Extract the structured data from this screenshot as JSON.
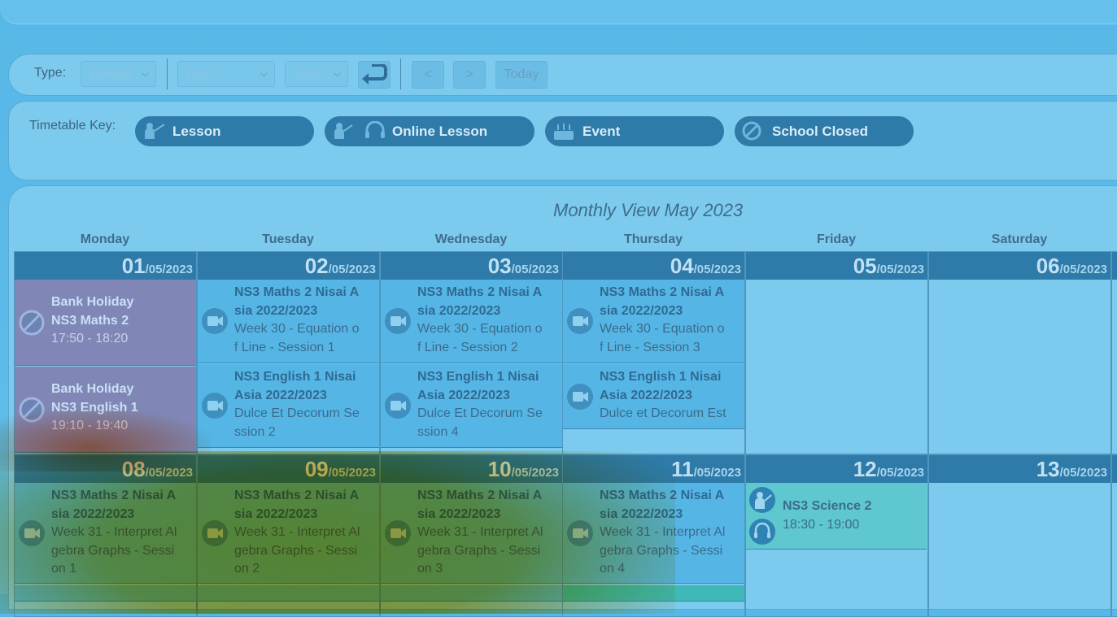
{
  "toolbar": {
    "type_label": "Type:",
    "type_value": "Monthly",
    "month_value": "May",
    "year_value": "2023",
    "prev_label": "<",
    "next_label": ">",
    "today_label": "Today"
  },
  "key": {
    "label": "Timetable Key:",
    "items": [
      {
        "label": "Lesson",
        "icon": "teacher-icon"
      },
      {
        "label": "Online Lesson",
        "icon": "teacher-headset-icon"
      },
      {
        "label": "Event",
        "icon": "cake-icon"
      },
      {
        "label": "School Closed",
        "icon": "no-entry-icon"
      }
    ]
  },
  "calendar": {
    "title": "Monthly View May 2023",
    "days": [
      "Monday",
      "Tuesday",
      "Wednesday",
      "Thursday",
      "Friday",
      "Saturday"
    ],
    "week1": [
      {
        "num": "01",
        "month": "/05/2023"
      },
      {
        "num": "02",
        "month": "/05/2023"
      },
      {
        "num": "03",
        "month": "/05/2023"
      },
      {
        "num": "04",
        "month": "/05/2023"
      },
      {
        "num": "05",
        "month": "/05/2023"
      },
      {
        "num": "06",
        "month": "/05/2023"
      }
    ],
    "week2": [
      {
        "num": "08",
        "month": "/05/2023"
      },
      {
        "num": "09",
        "month": "/05/2023"
      },
      {
        "num": "10",
        "month": "/05/2023"
      },
      {
        "num": "11",
        "month": "/05/2023"
      },
      {
        "num": "12",
        "month": "/05/2023"
      },
      {
        "num": "13",
        "month": "/05/2023"
      }
    ],
    "events": {
      "mon1a": [
        "Bank Holiday",
        "NS3 Maths 2",
        "17:50 - 18:20"
      ],
      "mon1b": [
        "Bank Holiday",
        "NS3 English 1",
        "19:10 - 19:40"
      ],
      "tue2a": [
        "NS3 Maths 2 Nisai A",
        "sia 2022/2023",
        "Week 30 - Equation o",
        "f Line - Session 1"
      ],
      "tue2b": [
        "NS3 English 1 Nisai",
        "Asia 2022/2023",
        "Dulce Et Decorum Se",
        "ssion 2"
      ],
      "wed3a": [
        "NS3 Maths 2 Nisai A",
        "sia 2022/2023",
        "Week 30 - Equation o",
        "f Line - Session 2"
      ],
      "wed3b": [
        "NS3 English 1 Nisai",
        "Asia 2022/2023",
        "Dulce Et Decorum Se",
        "ssion 4"
      ],
      "thu4a": [
        "NS3 Maths 2 Nisai A",
        "sia 2022/2023",
        "Week 30 - Equation o",
        "f Line - Session 3"
      ],
      "thu4b": [
        "NS3 English 1 Nisai",
        "Asia 2022/2023",
        "Dulce et Decorum Est"
      ],
      "mon8": [
        "NS3 Maths 2 Nisai A",
        "sia 2022/2023",
        "Week 31 - Interpret Al",
        "gebra Graphs - Sessi",
        "on 1"
      ],
      "tue9": [
        "NS3 Maths 2 Nisai A",
        "sia 2022/2023",
        "Week 31 - Interpret Al",
        "gebra Graphs - Sessi",
        "on 2"
      ],
      "wed10": [
        "NS3 Maths 2 Nisai A",
        "sia 2022/2023",
        "Week 31 - Interpret Al",
        "gebra Graphs - Sessi",
        "on 3"
      ],
      "thu11": [
        "NS3 Maths 2 Nisai A",
        "sia 2022/2023",
        "Week 31 - Interpret Al",
        "gebra Graphs - Sessi",
        "on 4"
      ],
      "fri12": [
        "NS3 Science 2",
        "18:30 - 19:00"
      ]
    }
  }
}
